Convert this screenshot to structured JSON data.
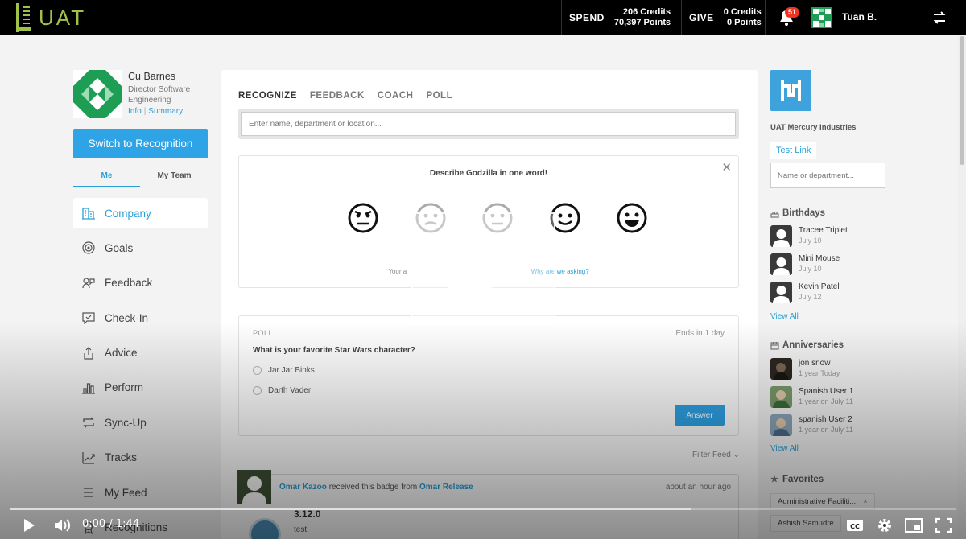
{
  "topbar": {
    "logo_text": "UAT",
    "spend_label": "SPEND",
    "spend_credits": "206 Credits",
    "spend_points": "70,397 Points",
    "give_label": "GIVE",
    "give_credits": "0 Credits",
    "give_points": "0 Points",
    "notifications_count": "51",
    "user_name": "Tuan B."
  },
  "profile": {
    "name": "Cu Barnes",
    "title": "Director Software Engineering",
    "info_link": "Info",
    "summary_link": "Summary"
  },
  "switch_button": "Switch to Recognition",
  "scope_tabs": {
    "me": "Me",
    "team": "My Team"
  },
  "nav": [
    {
      "label": "Company",
      "icon": "building-icon"
    },
    {
      "label": "Goals",
      "icon": "target-icon"
    },
    {
      "label": "Feedback",
      "icon": "feedback-icon"
    },
    {
      "label": "Check-In",
      "icon": "checkin-icon"
    },
    {
      "label": "Advice",
      "icon": "advice-icon"
    },
    {
      "label": "Perform",
      "icon": "bar-chart-icon"
    },
    {
      "label": "Sync-Up",
      "icon": "sync-icon"
    },
    {
      "label": "Tracks",
      "icon": "trend-icon"
    },
    {
      "label": "My Feed",
      "icon": "list-icon"
    },
    {
      "label": "Recognitions",
      "icon": "award-icon"
    }
  ],
  "center": {
    "tabs": [
      "RECOGNIZE",
      "FEEDBACK",
      "COACH",
      "POLL"
    ],
    "search_placeholder": "Enter name, department or location...",
    "survey": {
      "question": "Describe Godzilla in one word!",
      "note_prefix": "Your a",
      "note_link": "Why are we asking?"
    },
    "poll": {
      "label": "POLL",
      "ends": "Ends in 1 day",
      "question": "What is your favorite Star Wars character?",
      "options": [
        "Jar Jar Binks",
        "Darth Vader"
      ],
      "answer_button": "Answer"
    },
    "filter_feed": "Filter Feed",
    "feed_item": {
      "recipient": "Omar Kazoo",
      "text": "received this badge from",
      "sender": "Omar Release",
      "time": "about an hour ago",
      "version": "3.12.0",
      "note": "test"
    }
  },
  "right": {
    "org_name": "UAT Mercury Industries",
    "test_link": "Test Link",
    "search_placeholder": "Name or department...",
    "birthdays_title": "Birthdays",
    "birthdays": [
      {
        "name": "Tracee Triplet",
        "date": "July 10"
      },
      {
        "name": "Mini Mouse",
        "date": "July 10"
      },
      {
        "name": "Kevin Patel",
        "date": "July 12"
      }
    ],
    "view_all_1": "View All",
    "anniversaries_title": "Anniversaries",
    "anniversaries": [
      {
        "name": "jon snow",
        "date": "1 year Today"
      },
      {
        "name": "Spanish User 1",
        "date": "1 year on July 11"
      },
      {
        "name": "spanish User 2",
        "date": "1 year on July 11"
      }
    ],
    "view_all_2": "View All",
    "favorites_title": "Favorites",
    "favorites": [
      "Administrative Faciliti...",
      "Ashish Samudre"
    ]
  },
  "player": {
    "time": "0:00 / 1:44",
    "progress_loaded": 0.72,
    "played": 0
  }
}
